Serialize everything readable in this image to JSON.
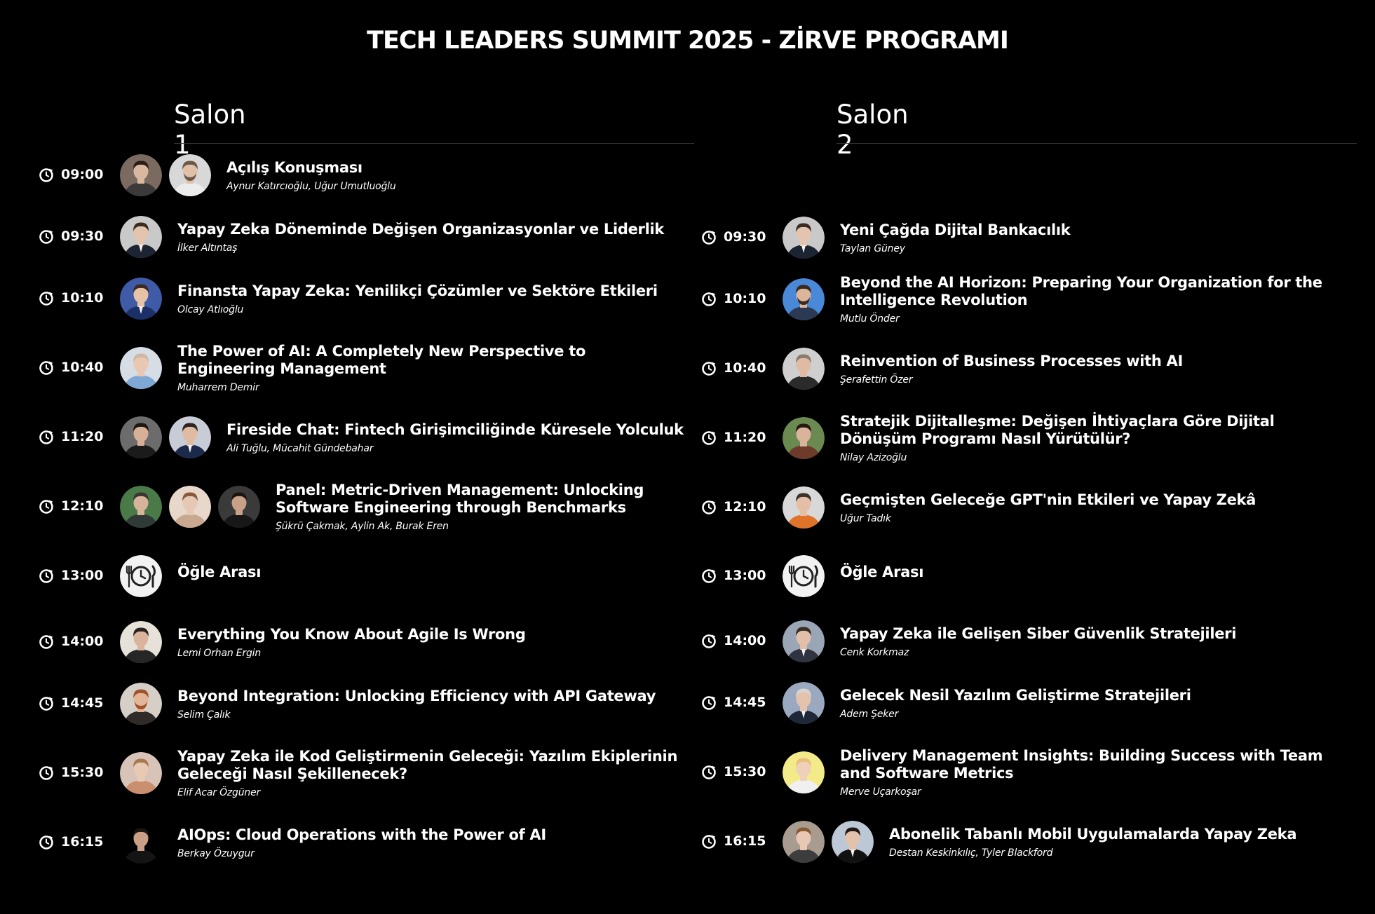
{
  "page": {
    "title": "TECH LEADERS SUMMIT 2025 - ZİRVE PROGRAMI"
  },
  "colors": {
    "background": "#000000",
    "text": "#ffffff",
    "divider": "#3a3a3a"
  },
  "salons": [
    {
      "name": "Salon 1",
      "sessions": [
        {
          "time": "09:00",
          "title": "Açılış Konuşması",
          "speakers": "Aynur Katırcıoğlu, Uğur Umutluoğlu",
          "avatars": [
            "avatar-woman-dark-hair",
            "avatar-man-beard"
          ]
        },
        {
          "time": "09:30",
          "title": "Yapay Zeka Döneminde Değişen Organizasyonlar ve Liderlik",
          "speakers": "İlker Altıntaş",
          "avatars": [
            "avatar-man-suit"
          ]
        },
        {
          "time": "10:10",
          "title": "Finansta Yapay Zeka: Yenilikçi Çözümler ve Sektöre Etkileri",
          "speakers": "Olcay Atlıoğlu",
          "avatars": [
            "avatar-man-suit-blue"
          ]
        },
        {
          "time": "10:40",
          "title": "The Power of AI: A Completely New Perspective to Engineering Management",
          "speakers": "Muharrem Demir",
          "avatars": [
            "avatar-man-bald"
          ]
        },
        {
          "time": "11:20",
          "title": "Fireside Chat: Fintech Girişimciliğinde Küresele Yolculuk",
          "speakers": "Ali Tuğlu, Mücahit Gündebahar",
          "avatars": [
            "avatar-man-stage",
            "avatar-man-suit-red-tie"
          ]
        },
        {
          "time": "12:10",
          "title": "Panel: Metric-Driven Management: Unlocking Software Engineering through Benchmarks",
          "speakers": "Şükrü Çakmak, Aylin Ak, Burak Eren",
          "avatars": [
            "avatar-man-glasses-green",
            "avatar-woman-light-hair",
            "avatar-man-dark"
          ]
        },
        {
          "time": "13:00",
          "title": "Öğle Arası",
          "speakers": "",
          "avatars": [
            "lunch-clock-icon"
          ]
        },
        {
          "time": "14:00",
          "title": "Everything You Know About Agile Is Wrong",
          "speakers": "Lemi Orhan Ergin",
          "avatars": [
            "avatar-man-casual"
          ]
        },
        {
          "time": "14:45",
          "title": "Beyond Integration: Unlocking Efficiency with API Gateway",
          "speakers": "Selim Çalık",
          "avatars": [
            "avatar-man-red-beard"
          ]
        },
        {
          "time": "15:30",
          "title": "Yapay Zeka ile Kod Geliştirmenin Geleceği: Yazılım Ekiplerinin Geleceği Nasıl Şekillenecek?",
          "speakers": "Elif Acar Özgüner",
          "avatars": [
            "avatar-woman-blonde"
          ]
        },
        {
          "time": "16:15",
          "title": "AIOps: Cloud Operations with the Power of AI",
          "speakers": "Berkay Özuygur",
          "avatars": [
            "avatar-man-stage-dark"
          ]
        }
      ]
    },
    {
      "name": "Salon 2",
      "sessions": [
        {
          "time": "09:30",
          "title": "Yeni Çağda Dijital Bankacılık",
          "speakers": "Taylan Güney",
          "avatars": [
            "avatar-man-suit"
          ]
        },
        {
          "time": "10:10",
          "title": "Beyond the AI Horizon: Preparing Your Organization for the Intelligence Revolution",
          "speakers": "Mutlu Önder",
          "avatars": [
            "avatar-man-beard-blue"
          ]
        },
        {
          "time": "10:40",
          "title": "Reinvention of Business Processes with AI",
          "speakers": "Şerafettin Özer",
          "avatars": [
            "avatar-man-older"
          ]
        },
        {
          "time": "11:20",
          "title": "Stratejik Dijitalleşme: Değişen İhtiyaçlara Göre Dijital Dönüşüm Programı Nasıl Yürütülür?",
          "speakers": "Nilay Azizoğlu",
          "avatars": [
            "avatar-woman-dark-curly"
          ]
        },
        {
          "time": "12:10",
          "title": "Geçmişten Geleceğe GPT'nin Etkileri ve Yapay Zekâ",
          "speakers": "Uğur Tadık",
          "avatars": [
            "avatar-man-orange"
          ]
        },
        {
          "time": "13:00",
          "title": "Öğle Arası",
          "speakers": "",
          "avatars": [
            "lunch-clock-icon"
          ]
        },
        {
          "time": "14:00",
          "title": "Yapay Zeka ile Gelişen Siber Güvenlik Stratejileri",
          "speakers": "Cenk Korkmaz",
          "avatars": [
            "avatar-man-suit-grey"
          ]
        },
        {
          "time": "14:45",
          "title": "Gelecek Nesil Yazılım Geliştirme Stratejileri",
          "speakers": "Adem Şeker",
          "avatars": [
            "avatar-man-older-suit"
          ]
        },
        {
          "time": "15:30",
          "title": "Delivery Management Insights: Building Success with Team and Software Metrics",
          "speakers": "Merve Uçarkoşar",
          "avatars": [
            "avatar-woman-blonde-yellow"
          ]
        },
        {
          "time": "16:15",
          "title": "Abonelik Tabanlı Mobil Uygulamalarda Yapay Zeka",
          "speakers": "Destan Keskinkılıç, Tyler Blackford",
          "avatars": [
            "avatar-woman-brown-hair",
            "avatar-man-tux"
          ]
        }
      ]
    }
  ]
}
